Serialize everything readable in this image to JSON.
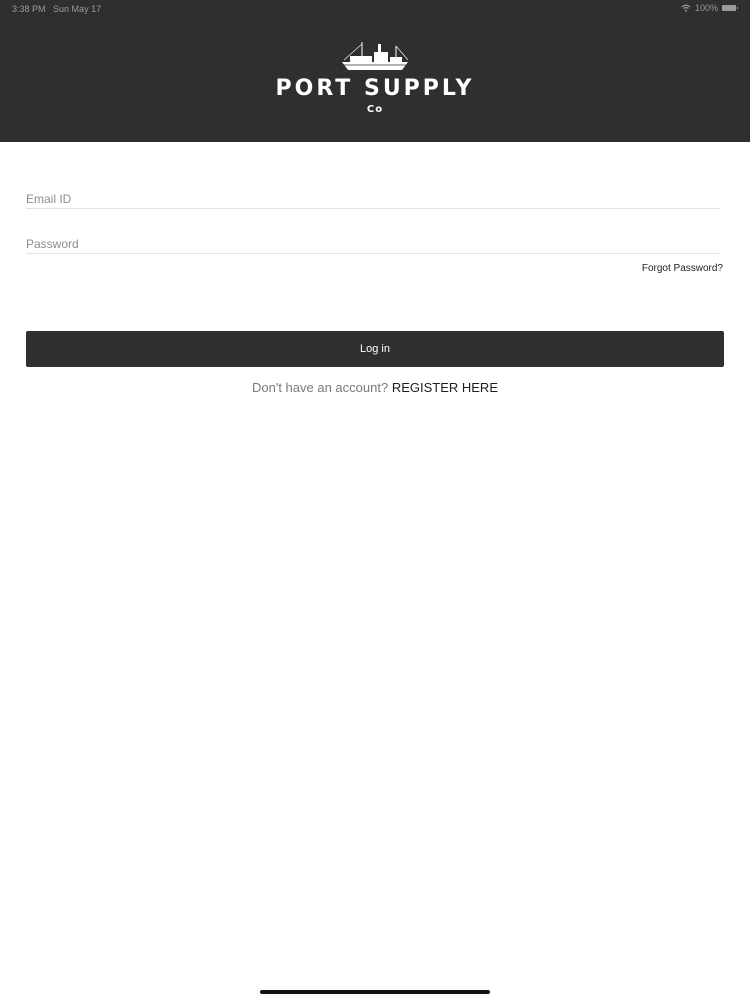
{
  "status_bar": {
    "time": "3:38 PM",
    "date": "Sun May 17",
    "battery": "100%",
    "wifi_icon": "wifi-icon",
    "battery_icon": "battery-icon"
  },
  "header": {
    "logo_icon": "ship-icon",
    "brand_name": "PORT SUPPLY",
    "brand_suffix": "Co",
    "background": "#2f2e30"
  },
  "form": {
    "email_label": "Email ID",
    "email_value": "",
    "password_label": "Password",
    "password_value": "",
    "forgot_label": "Forgot Password?",
    "login_label": "Log in"
  },
  "register": {
    "prompt": "Don't have an account?",
    "link_label": "REGISTER HERE"
  }
}
